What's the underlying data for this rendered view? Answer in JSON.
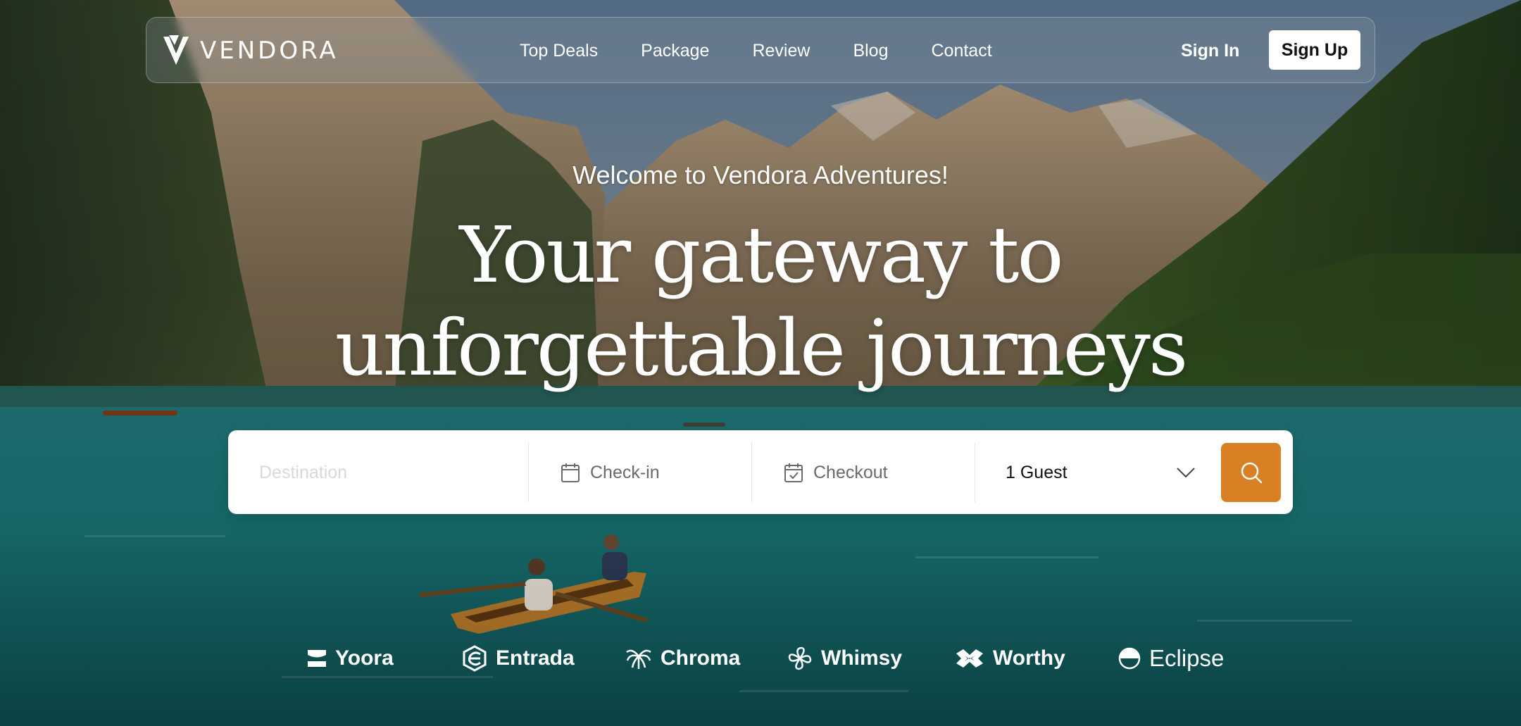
{
  "colors": {
    "accent": "#d98024",
    "white": "#ffffff"
  },
  "brand": {
    "name": "VENDORA",
    "icon": "vendora-v-icon"
  },
  "nav": {
    "links": [
      "Top Deals",
      "Package",
      "Review",
      "Blog",
      "Contact"
    ],
    "sign_in": "Sign In",
    "sign_up": "Sign Up"
  },
  "hero": {
    "welcome": "Welcome to Vendora Adventures!",
    "headline_line1": "Your gateway to",
    "headline_line2": "unforgettable journeys"
  },
  "search": {
    "destination_placeholder": "Destination",
    "checkin_label": "Check-in",
    "checkout_label": "Checkout",
    "guests_value": "1 Guest",
    "icons": [
      "calendar-icon",
      "calendar-check-icon",
      "chevron-down-icon",
      "search-icon"
    ]
  },
  "partners": [
    {
      "name": "Yoora",
      "icon": "yoora-logo-icon"
    },
    {
      "name": "Entrada",
      "icon": "entrada-logo-icon"
    },
    {
      "name": "Chroma",
      "icon": "chroma-logo-icon"
    },
    {
      "name": "Whimsy",
      "icon": "whimsy-logo-icon"
    },
    {
      "name": "Worthy",
      "icon": "worthy-logo-icon"
    },
    {
      "name": "Eclipse",
      "icon": "eclipse-logo-icon"
    }
  ]
}
